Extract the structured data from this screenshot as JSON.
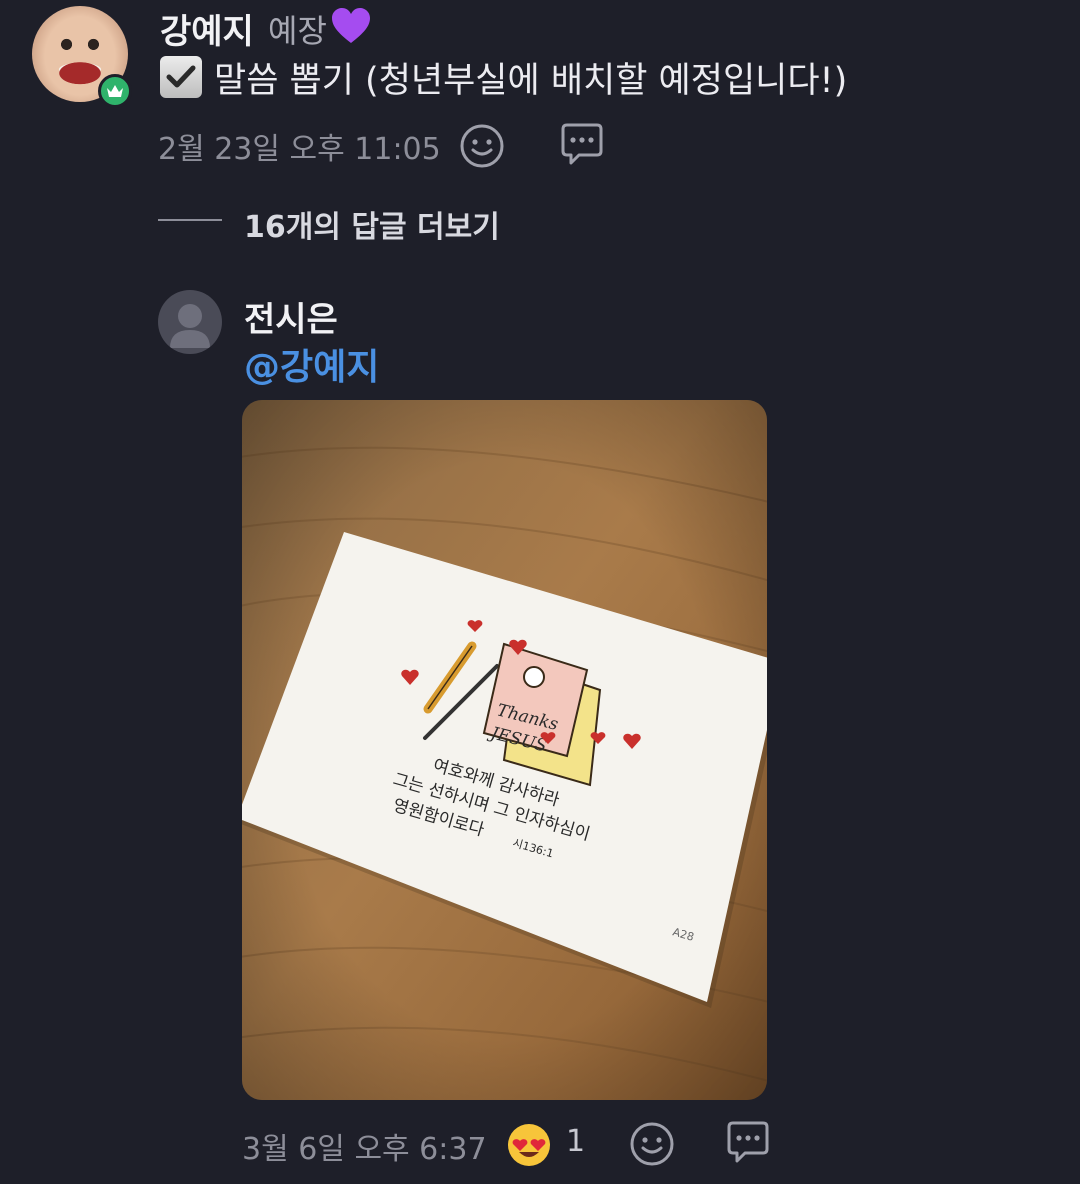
{
  "post": {
    "author": "강예지",
    "role": "예장",
    "text": "말씀 뽑기 (청년부실에 배치할 예정입니다!)",
    "timestamp": "2월 23일 오후 11:05",
    "badge_icon": "crown-icon",
    "badge_color": "#2fb36b"
  },
  "thread": {
    "more_replies": "16개의 답글 더보기"
  },
  "reply": {
    "author": "전시은",
    "mention": "@강예지",
    "timestamp": "3월 6일 오후 6:37",
    "reaction": {
      "emoji": "heart-eyes-emoji",
      "count": "1"
    },
    "card": {
      "thanks_line1": "Thanks",
      "thanks_line2": "JESUS",
      "verse_line1": "여호와께 감사하라",
      "verse_line2": "그는 선하시며 그 인자하심이",
      "verse_line3": "영원함이로다",
      "reference": "시136:1",
      "code": "A28"
    }
  },
  "colors": {
    "background": "#1e1f29",
    "mention": "#4a90e2",
    "muted": "#8d8e99"
  }
}
